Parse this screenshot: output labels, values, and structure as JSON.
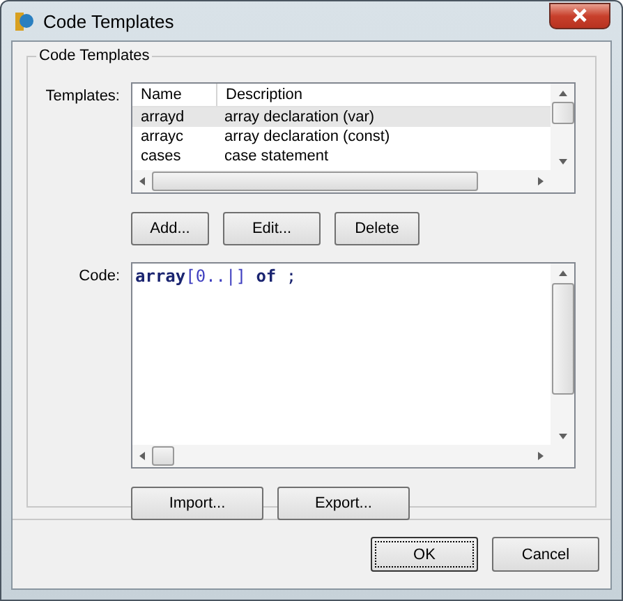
{
  "window": {
    "title": "Code Templates"
  },
  "group": {
    "title": "Code Templates"
  },
  "templates": {
    "label": "Templates:",
    "columns": [
      "Name",
      "Description"
    ],
    "rows": [
      {
        "name": "arrayd",
        "description": "array declaration (var)",
        "selected": true
      },
      {
        "name": "arrayc",
        "description": "array declaration (const)",
        "selected": false
      },
      {
        "name": "cases",
        "description": "case statement",
        "selected": false
      }
    ]
  },
  "list_buttons": [
    "Add...",
    "Edit...",
    "Delete"
  ],
  "code": {
    "label": "Code:",
    "tokens": [
      {
        "text": "array",
        "kind": "keyword"
      },
      {
        "text": "[0..|] ",
        "kind": "symbol"
      },
      {
        "text": "of",
        "kind": "keyword"
      },
      {
        "text": " ;",
        "kind": "plain"
      }
    ]
  },
  "code_buttons": [
    "Import...",
    "Export..."
  ],
  "dialog_buttons": [
    {
      "label": "OK",
      "default": true
    },
    {
      "label": "Cancel",
      "default": false
    }
  ]
}
